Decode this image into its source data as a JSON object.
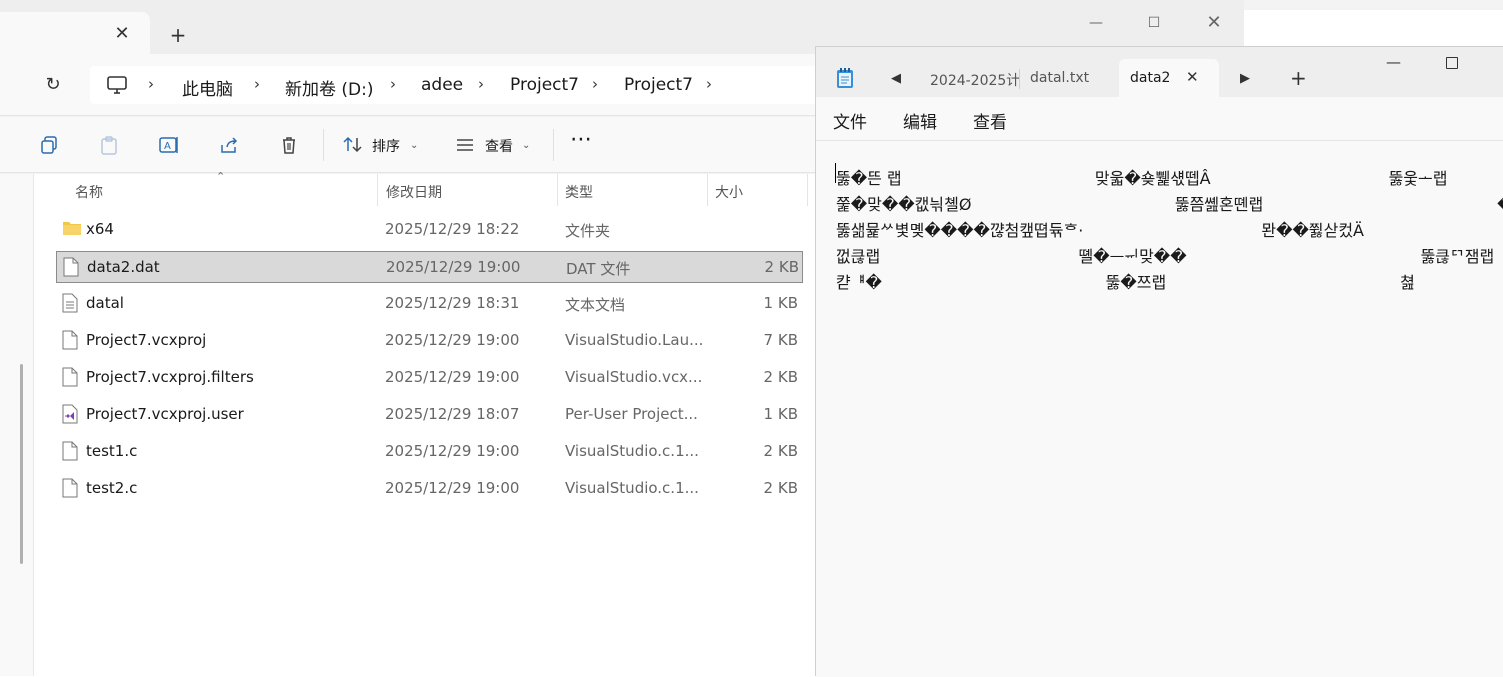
{
  "explorer": {
    "breadcrumbs": [
      "此电脑",
      "新加卷 (D:)",
      "adee",
      "Project7",
      "Project7"
    ],
    "toolbar": {
      "sort_label": "排序",
      "view_label": "查看"
    },
    "columns": {
      "name": "名称",
      "modified": "修改日期",
      "type": "类型",
      "size": "大小"
    },
    "files": [
      {
        "name": "x64",
        "modified": "2025/12/29 18:22",
        "type": "文件夹",
        "size": "",
        "icon": "folder-icon"
      },
      {
        "name": "data2.dat",
        "modified": "2025/12/29 19:00",
        "type": "DAT 文件",
        "size": "2 KB",
        "icon": "file-icon"
      },
      {
        "name": "datal",
        "modified": "2025/12/29 18:31",
        "type": "文本文档",
        "size": "1 KB",
        "icon": "text-file-icon"
      },
      {
        "name": "Project7.vcxproj",
        "modified": "2025/12/29 19:00",
        "type": "VisualStudio.Lau...",
        "size": "7 KB",
        "icon": "file-icon"
      },
      {
        "name": "Project7.vcxproj.filters",
        "modified": "2025/12/29 19:00",
        "type": "VisualStudio.vcx...",
        "size": "2 KB",
        "icon": "file-icon"
      },
      {
        "name": "Project7.vcxproj.user",
        "modified": "2025/12/29 18:07",
        "type": "Per-User Project...",
        "size": "1 KB",
        "icon": "vs-file-icon"
      },
      {
        "name": "test1.c",
        "modified": "2025/12/29 19:00",
        "type": "VisualStudio.c.1...",
        "size": "2 KB",
        "icon": "file-icon"
      },
      {
        "name": "test2.c",
        "modified": "2025/12/29 19:00",
        "type": "VisualStudio.c.1...",
        "size": "2 KB",
        "icon": "file-icon"
      }
    ],
    "selected_index": 1
  },
  "notepad": {
    "tabs": [
      "2024-2025计",
      "datal.txt",
      "data2"
    ],
    "active_tab": "data2",
    "menu": [
      "文件",
      "编辑",
      "查看"
    ],
    "lines": [
      "뚫�뜬 랩                                      맞욻�숒쀑섃뗍Â                                   뚫웇ᅩ랩",
      "쭕�맞��캢늮쳴Ø                                        뚫쯤쏊혼뗸랩                                              �쀈ᄬ쀒뮷짎",
      "뚫샒뮱ᄽ볓몢����꺊첨캪뗩듂ᄒ·                                   뫈��쮫삳컸Ä                                       뚫",
      "껎큲랩                                       뗼�ᅳᆔ맞��                                              뚫큲ᄗ잼랩",
      "캳ᅤ�                                            뚫�쯔랩                                              쳞"
    ]
  },
  "colors": {
    "selection": "#d9d9d9",
    "folder": "#f2c744"
  }
}
